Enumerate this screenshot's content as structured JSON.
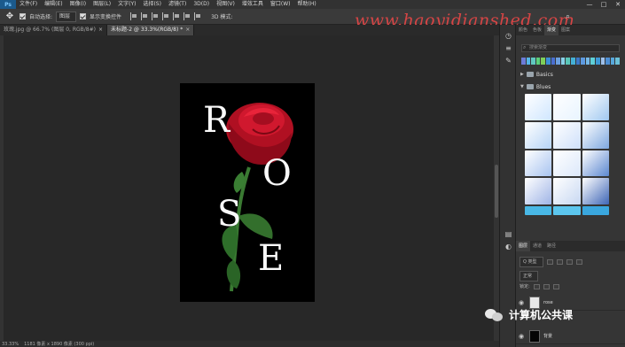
{
  "menu": {
    "items": [
      "文件(F)",
      "编辑(E)",
      "图像(I)",
      "图层(L)",
      "文字(Y)",
      "选择(S)",
      "滤镜(T)",
      "3D(D)",
      "视图(V)",
      "增效工具",
      "窗口(W)",
      "帮助(H)"
    ],
    "logo": "Ps",
    "window_controls": [
      "—",
      "□",
      "✕"
    ]
  },
  "options": {
    "auto_select_label": "自动选择:",
    "auto_select_value": "图层",
    "show_transform_label": "显示变换控件",
    "three_d_label": "3D 模式:"
  },
  "watermark": "www.haoyidianshed.com",
  "tabs": [
    {
      "label": "玫瑰.jpg @ 66.7% (图层 0, RGB/8#)",
      "active": false
    },
    {
      "label": "未标题-2 @ 33.3%(RGB/8) *",
      "active": true
    }
  ],
  "document": {
    "letters": [
      "R",
      "O",
      "S",
      "E"
    ]
  },
  "statusbar": {
    "zoom": "33.33%",
    "doc_info": "1181 像素 x 1890 像素 (300 ppi)"
  },
  "panel": {
    "tabs": [
      "颜色",
      "色板",
      "渐变",
      "图案"
    ],
    "active_tab": "渐变",
    "search_placeholder": "搜索渐变",
    "folders": [
      {
        "name": "Basics",
        "expanded": false
      },
      {
        "name": "Blues",
        "expanded": true
      }
    ],
    "swatch_colors": [
      "#6c7cd8",
      "#54b6e8",
      "#61c8c0",
      "#5ad07a",
      "#7ecf5a",
      "#3b8fd8",
      "#4a6fd0",
      "#6ca0e0",
      "#88d0e8",
      "#59c6b8",
      "#45b0d6",
      "#3c78c8",
      "#5e9ae0",
      "#74b8e6",
      "#5fd0d8",
      "#3d99d6",
      "#9ec0ea",
      "#4d8fd4",
      "#58a8dc",
      "#6bc0d8"
    ],
    "gradient_cells": [
      [
        "#cfe6ff",
        "#e8f4ff",
        "#a0c8f0"
      ],
      [
        "#b6d4f6",
        "#cfe0fa",
        "#7ea8e0"
      ],
      [
        "#a8c4f0",
        "#dce8fa",
        "#5c88d0"
      ],
      [
        "#9fb4e6",
        "#c8d8f2",
        "#3e66b6"
      ]
    ],
    "bottom_strip": [
      "#49b8e6",
      "#5cc6ee",
      "#3aa7de"
    ],
    "layers_tabs": [
      "图层",
      "通道",
      "路径"
    ],
    "layers_active_tab": "图层",
    "filter_label": "Q 类型",
    "blend_mode": "正常",
    "lock_label": "锁定:",
    "layers": [
      {
        "name": "rose",
        "visible": true,
        "thumb": "#e8e8e8"
      },
      {
        "name": "背景",
        "visible": true,
        "thumb": "#050505"
      }
    ]
  },
  "brand": {
    "name": "计算机公共课"
  },
  "colors": {
    "rose_red": "#c8142a",
    "stem_green": "#3a7a32",
    "leaf_green": "#2e6e2a",
    "watermark_red": "#d64545"
  }
}
